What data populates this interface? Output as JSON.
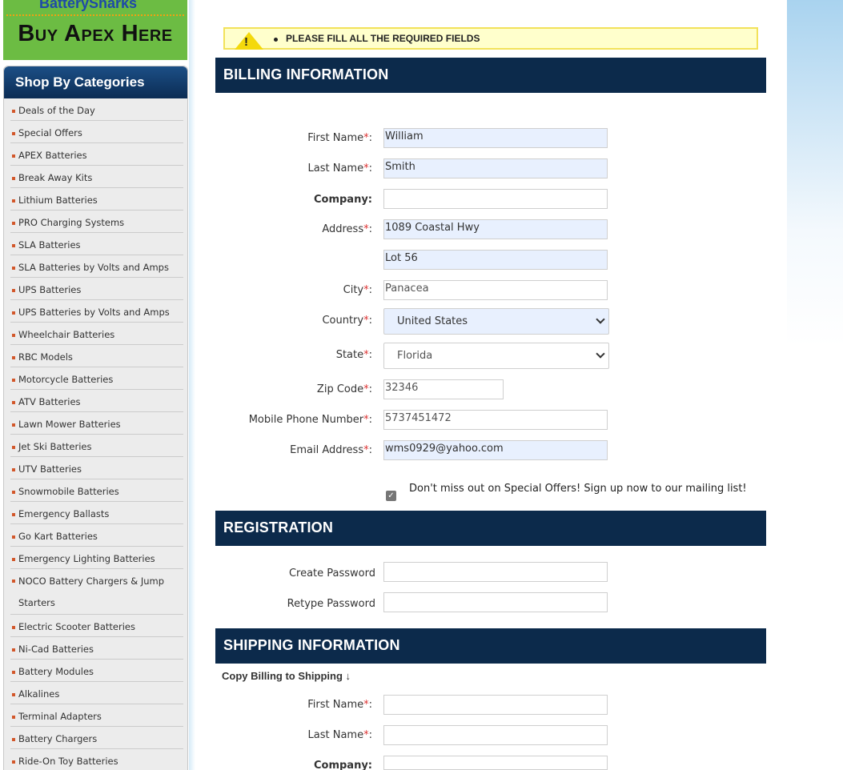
{
  "banner": {
    "brand": "BatterySharks",
    "cta": "Buy Apex Here"
  },
  "sidebar": {
    "title": "Shop By Categories",
    "categories": [
      "Deals of the Day",
      "Special Offers",
      "APEX Batteries",
      "Break Away Kits",
      "Lithium Batteries",
      "PRO Charging Systems",
      "SLA Batteries",
      "SLA Batteries by Volts and Amps",
      "UPS Batteries",
      "UPS Batteries by Volts and Amps",
      "Wheelchair Batteries",
      "RBC Models",
      "Motorcycle Batteries",
      "ATV Batteries",
      "Lawn Mower Batteries",
      "Jet Ski Batteries",
      "UTV Batteries",
      "Snowmobile Batteries",
      "Emergency Ballasts",
      "Go Kart Batteries",
      "Emergency Lighting Batteries",
      "NOCO Battery Chargers & Jump",
      "Starters",
      "Electric Scooter Batteries",
      "Ni-Cad Batteries",
      "Battery Modules",
      "Alkalines",
      "Terminal Adapters",
      "Battery Chargers",
      "Ride-On Toy Batteries"
    ]
  },
  "alert": {
    "icon": "warning-icon",
    "message": "PLEASE FILL ALL THE REQUIRED FIELDS"
  },
  "billing": {
    "title": "BILLING INFORMATION",
    "labels": {
      "first_name": "First Name",
      "last_name": "Last Name",
      "company": "Company:",
      "address": "Address",
      "city": "City",
      "country": "Country",
      "state": "State",
      "zip": "Zip Code",
      "phone": "Mobile Phone Number",
      "email": "Email Address"
    },
    "values": {
      "first_name": "William",
      "last_name": "Smith",
      "company": "",
      "address1": "1089 Coastal Hwy",
      "address2": "Lot 56",
      "city": "Panacea",
      "country": "United States",
      "state": "Florida",
      "zip": "32346",
      "phone": "5737451472",
      "email": "wms0929@yahoo.com"
    },
    "newsletter_checked": true,
    "newsletter_label": "Don't miss out on Special Offers! Sign up now to our mailing list!"
  },
  "registration": {
    "title": "REGISTRATION",
    "create_password": "Create Password",
    "retype_password": "Retype Password"
  },
  "shipping": {
    "title": "SHIPPING INFORMATION",
    "copy_link": "Copy Billing to Shipping ↓",
    "first_name": "First Name",
    "last_name": "Last Name",
    "company": "Company:"
  },
  "colors": {
    "section_bar": "#0c2a4b",
    "banner_green": "#6cbc43",
    "required": "#dd3333",
    "autofill": "#e8f0fe"
  }
}
